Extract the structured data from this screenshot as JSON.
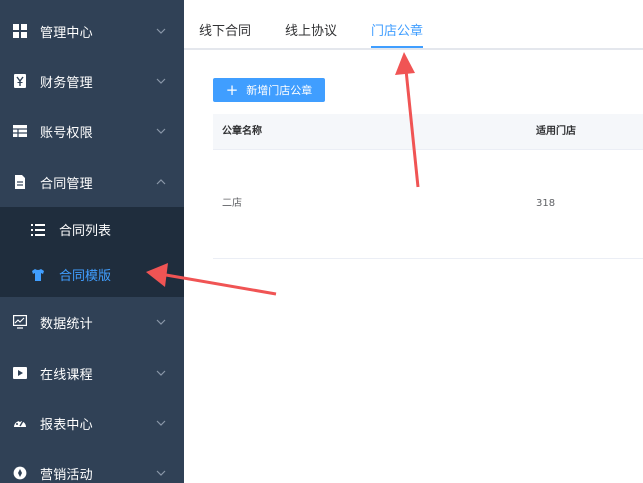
{
  "sidebar": {
    "items": [
      {
        "label": "管理中心",
        "icon": "grid-icon"
      },
      {
        "label": "财务管理",
        "icon": "yen-icon"
      },
      {
        "label": "账号权限",
        "icon": "table-icon"
      },
      {
        "label": "合同管理",
        "icon": "document-icon",
        "expanded": true
      },
      {
        "label": "数据统计",
        "icon": "monitor-chart-icon"
      },
      {
        "label": "在线课程",
        "icon": "play-icon"
      },
      {
        "label": "报表中心",
        "icon": "dashboard-icon"
      },
      {
        "label": "营销活动",
        "icon": "compass-icon"
      }
    ],
    "submenu": [
      {
        "label": "合同列表",
        "icon": "list-icon"
      },
      {
        "label": "合同模版",
        "icon": "shirt-icon",
        "active": true
      }
    ]
  },
  "tabs": [
    {
      "label": "线下合同"
    },
    {
      "label": "线上协议"
    },
    {
      "label": "门店公章",
      "active": true
    }
  ],
  "toolbar": {
    "add_label": "新增门店公章"
  },
  "table": {
    "columns": [
      "公章名称",
      "适用门店"
    ],
    "rows": [
      [
        "二店",
        "318"
      ]
    ]
  },
  "colors": {
    "sidebar_bg": "#304156",
    "submenu_bg": "#1f2d3d",
    "accent": "#409eff",
    "annotation": "#f05454"
  }
}
